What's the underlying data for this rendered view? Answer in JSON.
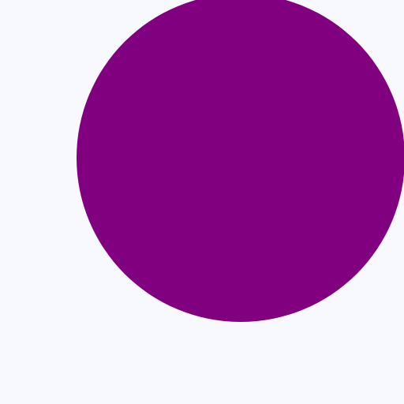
{
  "scene": {
    "background_color": "#f8f8ff",
    "shapes": [
      {
        "kind": "circle",
        "name": "purple-circle",
        "fill": "#800080"
      }
    ]
  }
}
